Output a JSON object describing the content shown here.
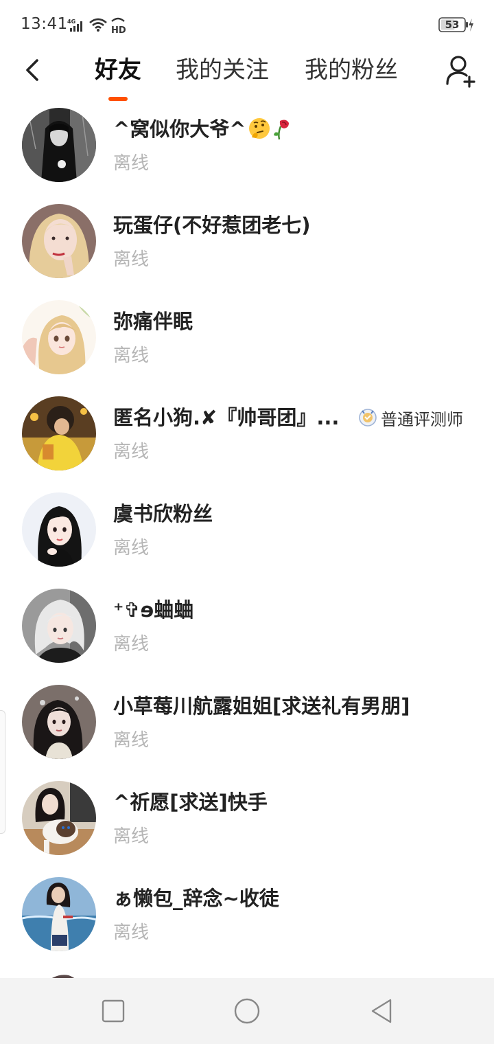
{
  "status_bar": {
    "time": "13:41",
    "network": "4G",
    "hd": "HD",
    "battery": "53"
  },
  "nav": {
    "tabs": [
      {
        "label": "好友",
        "active": true
      },
      {
        "label": "我的关注",
        "active": false
      },
      {
        "label": "我的粉丝",
        "active": false
      }
    ],
    "accent_color": "#ff5000"
  },
  "friends": [
    {
      "name": "^窝似你大爷^",
      "status": "离线",
      "emojis": [
        "thinking-face",
        "wilted-rose"
      ]
    },
    {
      "name": "玩蛋仔(不好惹团老七)",
      "status": "离线"
    },
    {
      "name": "弥痛伴眠",
      "status": "离线"
    },
    {
      "name": "匿名小狗.✘『帅哥团』...",
      "status": "离线",
      "badge": "普通评测师"
    },
    {
      "name": "虞书欣粉丝",
      "status": "离线"
    },
    {
      "name": "⁺✞ɘ蛐蛐",
      "status": "离线"
    },
    {
      "name": "小草莓川航露姐姐[求送礼有男朋]",
      "status": "离线"
    },
    {
      "name": "^祈愿[求送]快手",
      "status": "离线"
    },
    {
      "name": "ぁ懒包_辞念~收徒",
      "status": "离线"
    }
  ],
  "icons": {
    "back": "chevron-left-icon",
    "add_friend": "add-user-icon",
    "system_nav": [
      "square-recent-icon",
      "circle-home-icon",
      "triangle-back-icon"
    ]
  }
}
